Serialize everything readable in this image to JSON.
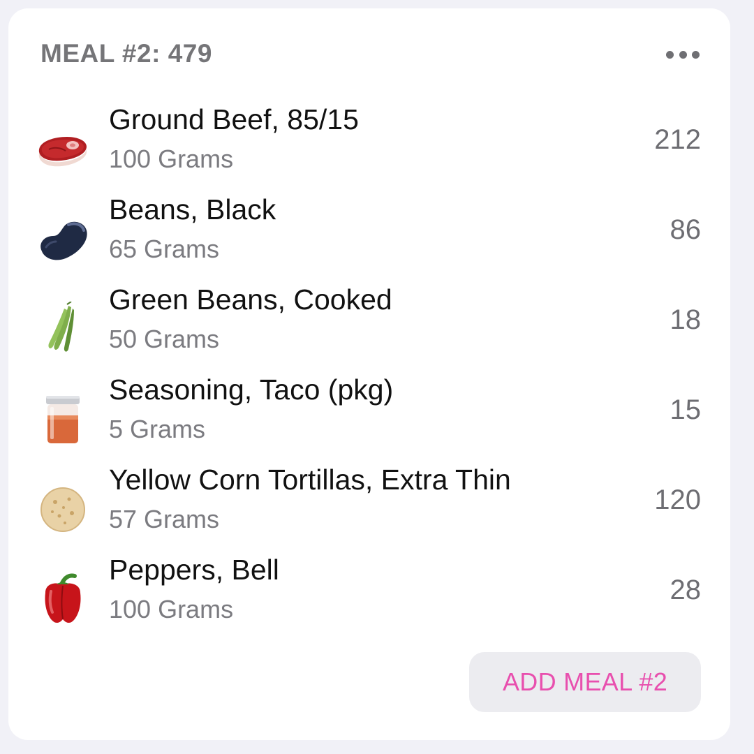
{
  "meal": {
    "title": "MEAL #2: 479",
    "add_button_label": "ADD MEAL #2"
  },
  "items": [
    {
      "name": "Ground Beef, 85/15",
      "amount": "100 Grams",
      "calories": "212",
      "icon": "steak-icon"
    },
    {
      "name": "Beans, Black",
      "amount": "65 Grams",
      "calories": "86",
      "icon": "black-bean-icon"
    },
    {
      "name": "Green Beans, Cooked",
      "amount": "50 Grams",
      "calories": "18",
      "icon": "green-beans-icon"
    },
    {
      "name": "Seasoning, Taco (pkg)",
      "amount": "5 Grams",
      "calories": "15",
      "icon": "spice-jar-icon"
    },
    {
      "name": "Yellow Corn Tortillas, Extra Thin",
      "amount": "57 Grams",
      "calories": "120",
      "icon": "tortilla-icon"
    },
    {
      "name": "Peppers, Bell",
      "amount": "100 Grams",
      "calories": "28",
      "icon": "bell-pepper-icon"
    }
  ],
  "colors": {
    "accent": "#e84fae",
    "background": "#f1f1f7",
    "card": "#ffffff"
  }
}
